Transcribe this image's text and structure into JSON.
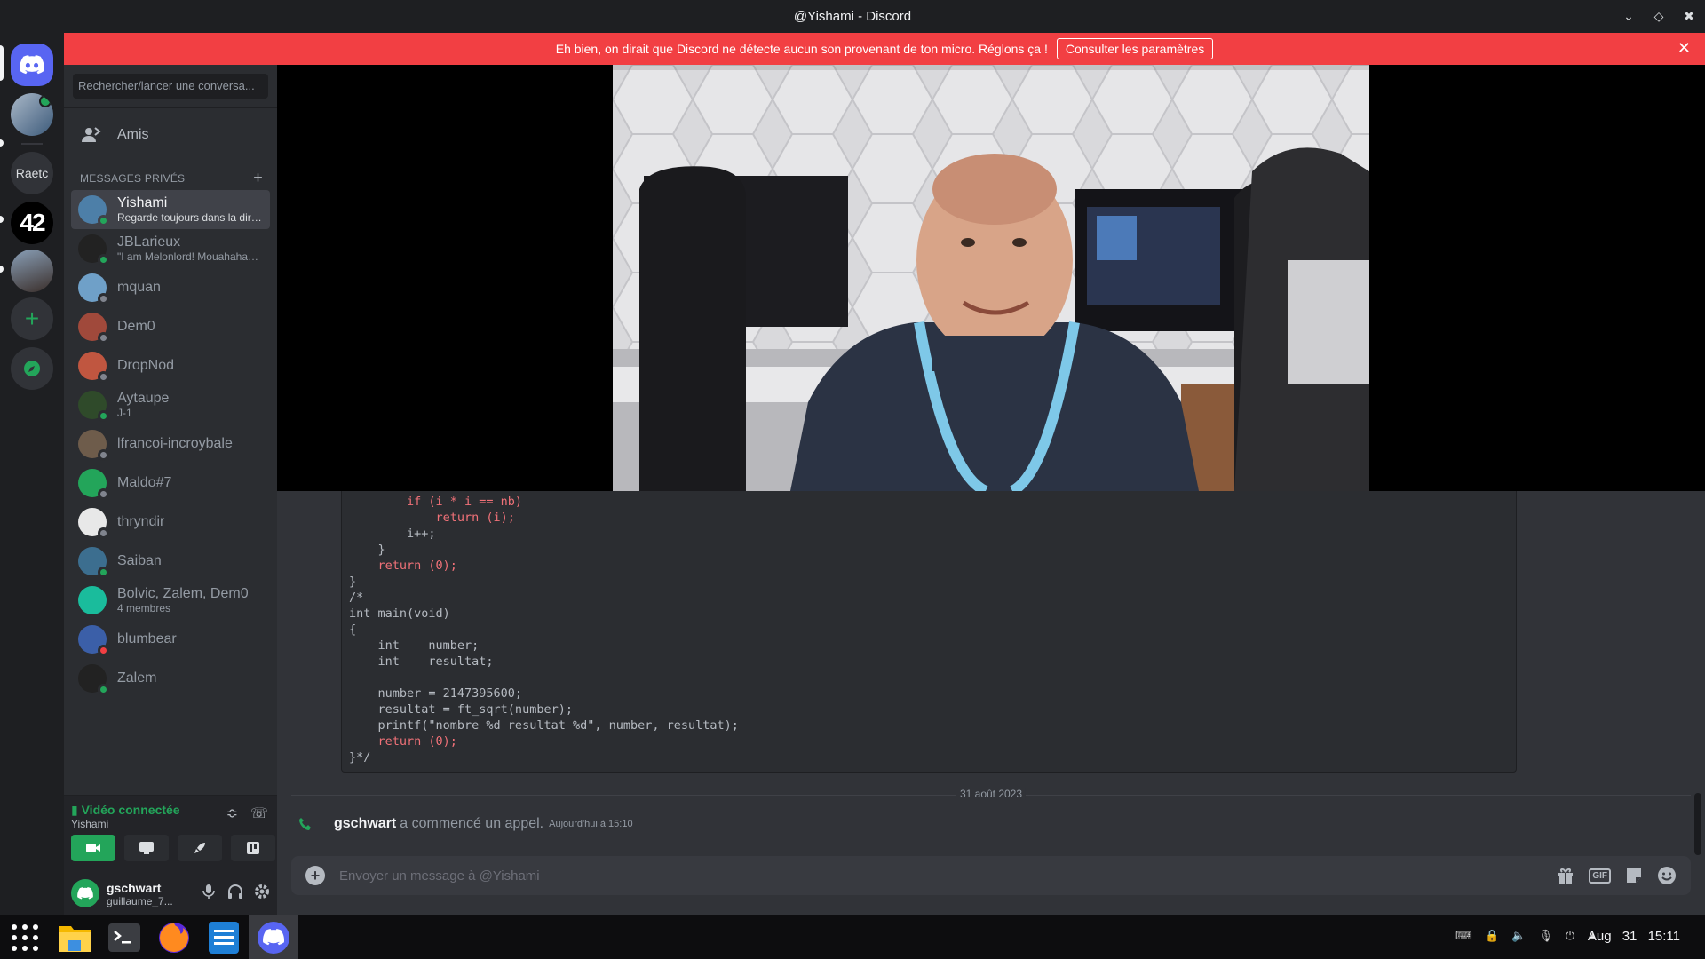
{
  "window": {
    "title": "@Yishami - Discord"
  },
  "banner": {
    "text": "Eh bien, on dirait que Discord ne détecte aucun son provenant de ton micro. Réglons ça !",
    "button": "Consulter les paramètres"
  },
  "guilds": [
    "Raetc"
  ],
  "sidebar": {
    "search_placeholder": "Rechercher/lancer une conversa...",
    "friends_label": "Amis",
    "dm_header": "MESSAGES PRIVÉS",
    "dms": [
      {
        "name": "Yishami",
        "sub": "Regarde toujours dans la dire...",
        "color": "#4d7fa8",
        "status": "#23a55a"
      },
      {
        "name": "JBLarieux",
        "sub": "\"I am Melonlord! Mouahahaha...",
        "color": "#222",
        "status": "#23a55a"
      },
      {
        "name": "mquan",
        "sub": "",
        "color": "#6fa0c8",
        "status": "#80848e"
      },
      {
        "name": "Dem0",
        "sub": "",
        "color": "#a0493b",
        "status": "#80848e"
      },
      {
        "name": "DropNod",
        "sub": "",
        "color": "#c05640",
        "status": "#80848e"
      },
      {
        "name": "Aytaupe",
        "sub": "J-1",
        "color": "#2f4a2a",
        "status": "#23a55a"
      },
      {
        "name": "lfrancoi-incroybale",
        "sub": "",
        "color": "#6e5c4b",
        "status": "#80848e"
      },
      {
        "name": "Maldo#7",
        "sub": "",
        "color": "#23a55a",
        "status": "#80848e"
      },
      {
        "name": "thryndir",
        "sub": "",
        "color": "#e8e8e8",
        "status": "#80848e"
      },
      {
        "name": "Saiban",
        "sub": "",
        "color": "#3c6e8f",
        "status": "#23a55a"
      },
      {
        "name": "Bolvic, Zalem, Dem0",
        "sub": "4 membres",
        "color": "#1abc9c",
        "status": ""
      },
      {
        "name": "blumbear",
        "sub": "",
        "color": "#3b5fa8",
        "status": "#f23f43"
      },
      {
        "name": "Zalem",
        "sub": "",
        "color": "#222",
        "status": "#23a55a"
      }
    ]
  },
  "voice": {
    "title": "Vidéo connectée",
    "channel": "Yishami"
  },
  "user": {
    "name": "gschwart",
    "tag": "guillaume_7..."
  },
  "code": [
    "        if (i * i == nb)",
    "            return (i);",
    "        i++;",
    "    }",
    "    return (0);",
    "}",
    "/*",
    "int main(void)",
    "{",
    "    int    number;",
    "    int    resultat;",
    "",
    "    number = 2147395600;",
    "    resultat = ft_sqrt(number);",
    "    printf(\"nombre %d resultat %d\", number, resultat);",
    "    return (0);",
    "}*/"
  ],
  "chat": {
    "date": "31 août 2023",
    "call_user": "gschwart",
    "call_text": "a commencé un appel.",
    "call_time": "Aujourd'hui à 15:10",
    "composer_placeholder": "Envoyer un message à @Yishami",
    "gif_label": "GIF"
  },
  "taskbar": {
    "clock": "Aug 31  15:11"
  },
  "colors": {
    "accent": "#5865f2",
    "danger": "#f23f43",
    "online": "#23a55a"
  }
}
